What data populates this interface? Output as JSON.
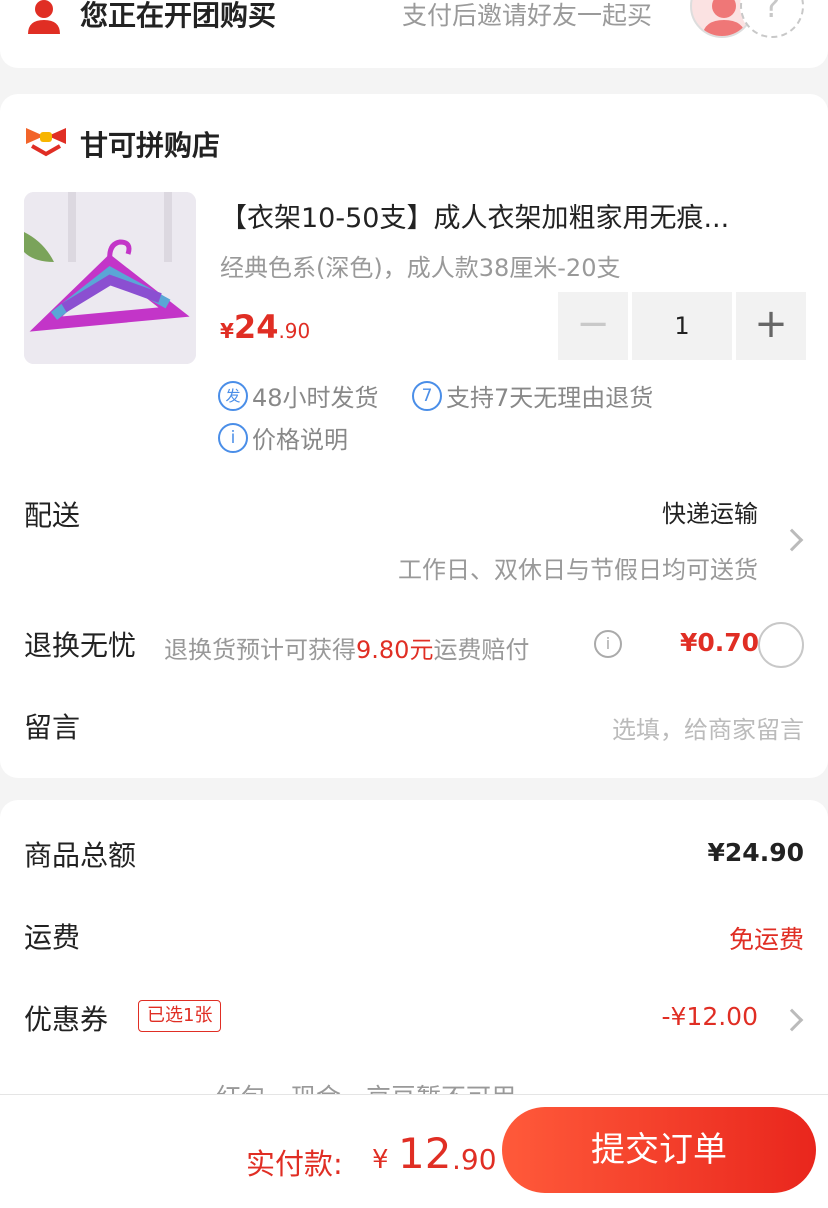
{
  "group_banner": {
    "title": "您正在开团购买",
    "hint": "支付后邀请好友一起买",
    "empty_slot": "?"
  },
  "order": {
    "shop_name": "甘可拼购店",
    "product": {
      "title": "【衣架10-50支】成人衣架加粗家用无痕...",
      "sku": "经典色系(深色)，成人款38厘米-20支",
      "price_currency": "¥",
      "price_int": "24",
      "price_dec": ".90",
      "quantity": "1",
      "minus": "−",
      "plus": "+"
    },
    "services": {
      "ship_icon": "发",
      "ship_text": "48小时发货",
      "return_icon": "7",
      "return_text": "支持7天无理由退货",
      "info_icon": "i",
      "price_note": "价格说明"
    },
    "delivery": {
      "label": "配送",
      "method": "快递运输",
      "note": "工作日、双休日与节假日均可送货"
    },
    "return_worry_free": {
      "label": "退换无忧",
      "desc_prefix": "退换货预计可获得",
      "desc_amount": "9.80元",
      "desc_suffix": "运费赔付",
      "info_icon": "i",
      "fee": "¥0.70"
    },
    "message": {
      "label": "留言",
      "placeholder": "选填，给商家留言"
    }
  },
  "summary": {
    "goods_total_label": "商品总额",
    "goods_total_value": "¥24.90",
    "shipping_label": "运费",
    "shipping_value": "免运费",
    "coupon_label": "优惠券",
    "coupon_badge": "已选1张",
    "coupon_value": "-¥12.00",
    "more_text": "红包、现金、京豆暂不可用"
  },
  "bottom_bar": {
    "pay_label": "实付款:",
    "pay_currency": "¥",
    "pay_int": "12",
    "pay_dec": ".90",
    "submit_label": "提交订单"
  },
  "colors": {
    "accent_red": "#e02e24",
    "info_blue": "#4a8ee8"
  }
}
